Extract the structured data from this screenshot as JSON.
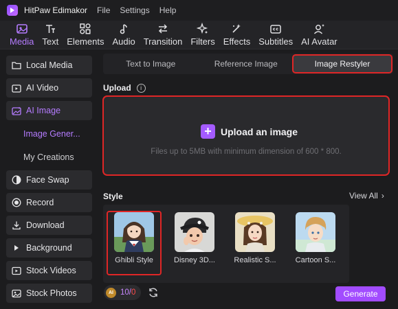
{
  "app": {
    "title": "HitPaw Edimakor",
    "menu": [
      "File",
      "Settings",
      "Help"
    ]
  },
  "toolbar": {
    "items": [
      {
        "label": "Media",
        "icon": "media-icon"
      },
      {
        "label": "Text",
        "icon": "text-icon"
      },
      {
        "label": "Elements",
        "icon": "elements-icon"
      },
      {
        "label": "Audio",
        "icon": "audio-icon"
      },
      {
        "label": "Transition",
        "icon": "transition-icon"
      },
      {
        "label": "Filters",
        "icon": "filters-icon"
      },
      {
        "label": "Effects",
        "icon": "effects-icon"
      },
      {
        "label": "Subtitles",
        "icon": "subtitles-icon"
      },
      {
        "label": "AI Avatar",
        "icon": "ai-avatar-icon"
      }
    ],
    "active": "Media"
  },
  "sidebar": {
    "items": [
      {
        "label": "Local Media",
        "icon": "folder-icon"
      },
      {
        "label": "AI Video",
        "icon": "ai-video-icon"
      },
      {
        "label": "AI Image",
        "icon": "ai-image-icon"
      },
      {
        "label": "Face Swap",
        "icon": "face-swap-icon"
      },
      {
        "label": "Record",
        "icon": "record-icon"
      },
      {
        "label": "Download",
        "icon": "download-icon"
      },
      {
        "label": "Background",
        "icon": "play-triangle-icon"
      },
      {
        "label": "Stock Videos",
        "icon": "stock-videos-icon"
      },
      {
        "label": "Stock Photos",
        "icon": "stock-photos-icon"
      }
    ],
    "subitems": [
      "Image Gener...",
      "My Creations"
    ]
  },
  "tabs": [
    "Text to Image",
    "Reference Image",
    "Image Restyler"
  ],
  "upload": {
    "label": "Upload",
    "title": "Upload an image",
    "hint": "Files up to 5MB with minimum dimension of 600 * 800."
  },
  "style_section": {
    "label": "Style",
    "view_all": "View All",
    "styles": [
      "Ghibli Style",
      "Disney 3D...",
      "Realistic S...",
      "Cartoon S..."
    ]
  },
  "credits": {
    "used": "10",
    "separator": "/",
    "total": "0",
    "badge": "AI"
  },
  "generate_label": "Generate",
  "colors": {
    "accent": "#a24cff",
    "highlight": "#e02626"
  }
}
